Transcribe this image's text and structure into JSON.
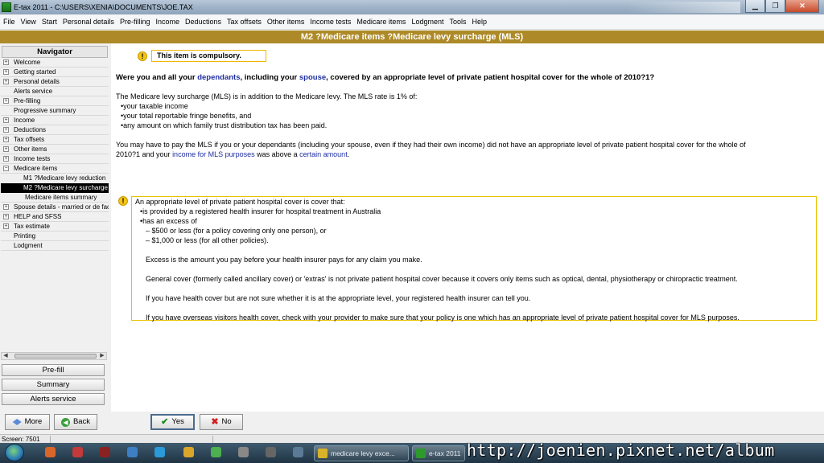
{
  "window": {
    "title": "E-tax 2011 - C:\\USERS\\XENIA\\DOCUMENTS\\JOE.TAX",
    "controls": [
      "minimize",
      "maximize",
      "close"
    ]
  },
  "menu": [
    "File",
    "View",
    "Start",
    "Personal details",
    "Pre-filling",
    "Income",
    "Deductions",
    "Tax offsets",
    "Other items",
    "Income tests",
    "Medicare items",
    "Lodgment",
    "Tools",
    "Help"
  ],
  "header": {
    "title": "M2 ?Medicare items ?Medicare levy surcharge (MLS)"
  },
  "navigator": {
    "title": "Navigator",
    "items": [
      {
        "label": "Welcome",
        "expander": "+"
      },
      {
        "label": "Getting started",
        "expander": "+"
      },
      {
        "label": "Personal details",
        "expander": "+"
      },
      {
        "label": "Alerts service",
        "expander": ""
      },
      {
        "label": "Pre-filling",
        "expander": "+"
      },
      {
        "label": "Progressive summary",
        "expander": ""
      },
      {
        "label": "Income",
        "expander": "+"
      },
      {
        "label": "Deductions",
        "expander": "+"
      },
      {
        "label": "Tax offsets",
        "expander": "+"
      },
      {
        "label": "Other items",
        "expander": "+"
      },
      {
        "label": "Income tests",
        "expander": "+"
      },
      {
        "label": "Medicare items",
        "expander": "−"
      },
      {
        "label": "M1 ?Medicare levy reduction",
        "expander": "",
        "sub": true
      },
      {
        "label": "M2 ?Medicare levy surcharge",
        "expander": "",
        "sub": true,
        "selected": true
      },
      {
        "label": "Medicare items summary",
        "expander": "",
        "sub": true
      },
      {
        "label": "Spouse details - married or de facto",
        "expander": "+"
      },
      {
        "label": "HELP and SFSS",
        "expander": "+"
      },
      {
        "label": "Tax estimate",
        "expander": "+"
      },
      {
        "label": "Printing",
        "expander": ""
      },
      {
        "label": "Lodgment",
        "expander": ""
      }
    ],
    "buttons": [
      "Pre-fill",
      "Summary",
      "Alerts service"
    ]
  },
  "content": {
    "compulsory_notice": "This item is compulsory.",
    "question": {
      "part1": "Were you and all your ",
      "link1": "dependants",
      "part2": ", including your ",
      "link2": "spouse",
      "part3": ", covered by an appropriate level of private patient hospital cover for the whole of 2010?1?"
    },
    "mls_intro": "The Medicare levy surcharge (MLS) is in addition to the Medicare levy. The MLS rate is 1% of:",
    "mls_bullets": [
      "your taxable income",
      "your total reportable fringe benefits, and",
      "any amount on which family trust distribution tax has been paid."
    ],
    "pay_para": {
      "line1": "You may have to pay the MLS if you or your dependants (including your spouse, even if they had their own income) did not have an appropriate level of private patient hospital cover for the whole of",
      "line2_part1": "2010?1 and your ",
      "link1": "income for MLS purposes",
      "line2_part2": " was above a ",
      "link2": "certain amount",
      "line2_part3": "."
    },
    "info": {
      "intro": "An appropriate level of private patient hospital cover is cover that:",
      "bullet1": "is provided by a registered health insurer for hospital treatment in Australia",
      "bullet2": "has an excess of",
      "dash1": "– $500 or less (for a policy covering only one person), or",
      "dash2": "– $1,000 or less (for all other policies).",
      "excess": "Excess is the amount you pay before your health insurer pays for any claim you make.",
      "general": "General cover (formerly called ancillary cover) or 'extras' is not private patient hospital cover because it covers only items such as optical, dental, physiotherapy or chiropractic treatment.",
      "unsure": "If you have health cover but are not sure whether it is at the appropriate level, your registered health insurer can tell you.",
      "overseas": "If you have overseas visitors health cover, check with your provider to make sure that your policy is one which has an appropriate level of private patient hospital cover for MLS purposes."
    }
  },
  "bottom": {
    "more": "More",
    "back": "Back",
    "yes": "Yes",
    "no": "No"
  },
  "status": {
    "screen": "Screen: 7501"
  },
  "taskbar": {
    "task1": "medicare levy exce...",
    "task2": "e-tax 2011"
  },
  "watermark": "http://joenien.pixnet.net/album"
}
